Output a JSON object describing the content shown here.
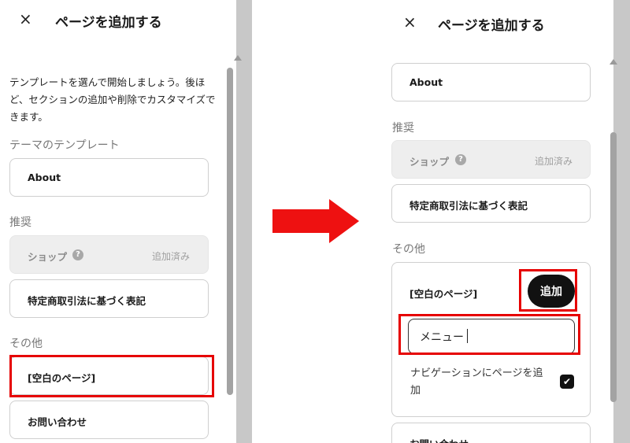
{
  "left": {
    "close_icon": "×",
    "title": "ページを追加する",
    "intro": "テンプレートを選んで開始しましょう。後ほど、セクションの追加や削除でカスタマイズできます。",
    "theme_section": "テーマのテンプレート",
    "about": "About",
    "recommended_section": "推奨",
    "shop": "ショップ",
    "shop_help": "?",
    "shop_status": "追加済み",
    "tokutei": "特定商取引法に基づく表記",
    "other_section": "その他",
    "blank_page": "[空白のページ]",
    "contact": "お問い合わせ"
  },
  "right": {
    "close_icon": "×",
    "title": "ページを追加する",
    "about": "About",
    "recommended_section": "推奨",
    "shop": "ショップ",
    "shop_help": "?",
    "shop_status": "追加済み",
    "tokutei": "特定商取引法に基づく表記",
    "other_section": "その他",
    "blank_page": "[空白のページ]",
    "add_button": "追加",
    "name_input_value": "メニュー",
    "nav_checkbox_label": "ナビゲーションにページを追加",
    "checkbox_mark": "✔",
    "contact": "お問い合わせ"
  },
  "colors": {
    "highlight": "#e60000",
    "arrow": "#ee1111",
    "add_button_bg": "#111111",
    "scrollbar_track": "#c8c8c8"
  }
}
